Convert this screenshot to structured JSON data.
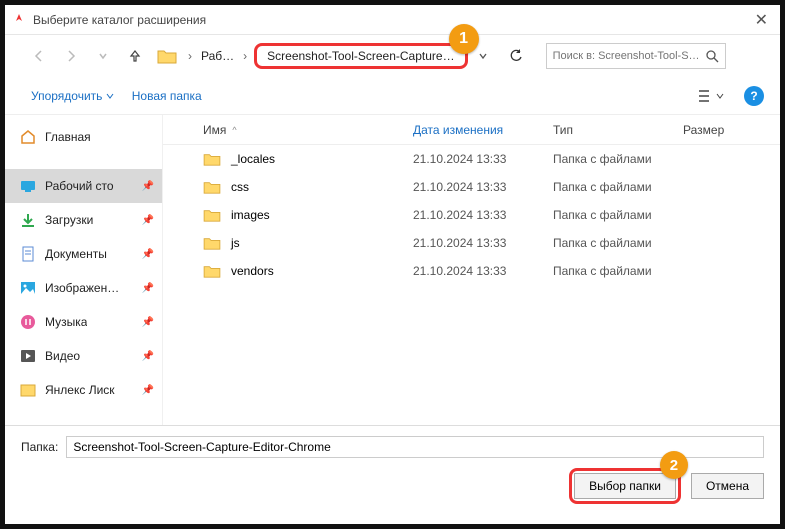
{
  "window": {
    "title": "Выберите каталог расширения",
    "close": "✕"
  },
  "nav": {
    "crumb1": "Раб…",
    "crumb2": "Screenshot-Tool-Screen-Capture…",
    "search_placeholder": "Поиск в: Screenshot-Tool-S…"
  },
  "toolbar": {
    "organize": "Упорядочить",
    "new_folder": "Новая папка"
  },
  "headers": {
    "name": "Имя",
    "date": "Дата изменения",
    "type": "Тип",
    "size": "Размер"
  },
  "sidebar": {
    "items": [
      {
        "label": "Главная",
        "pin": false
      },
      {
        "label": "Рабочий сто",
        "pin": true,
        "selected": true
      },
      {
        "label": "Загрузки",
        "pin": true
      },
      {
        "label": "Документы",
        "pin": true
      },
      {
        "label": "Изображен…",
        "pin": true
      },
      {
        "label": "Музыка",
        "pin": true
      },
      {
        "label": "Видео",
        "pin": true
      },
      {
        "label": "Янлекс Лиск",
        "pin": true
      }
    ]
  },
  "files": [
    {
      "name": "_locales",
      "date": "21.10.2024 13:33",
      "type": "Папка с файлами"
    },
    {
      "name": "css",
      "date": "21.10.2024 13:33",
      "type": "Папка с файлами"
    },
    {
      "name": "images",
      "date": "21.10.2024 13:33",
      "type": "Папка с файлами"
    },
    {
      "name": "js",
      "date": "21.10.2024 13:33",
      "type": "Папка с файлами"
    },
    {
      "name": "vendors",
      "date": "21.10.2024 13:33",
      "type": "Папка с файлами"
    }
  ],
  "bottom": {
    "folder_label": "Папка:",
    "folder_value": "Screenshot-Tool-Screen-Capture-Editor-Chrome",
    "select": "Выбор папки",
    "cancel": "Отмена"
  },
  "badges": {
    "one": "1",
    "two": "2"
  },
  "icons": {
    "sort": "^"
  }
}
